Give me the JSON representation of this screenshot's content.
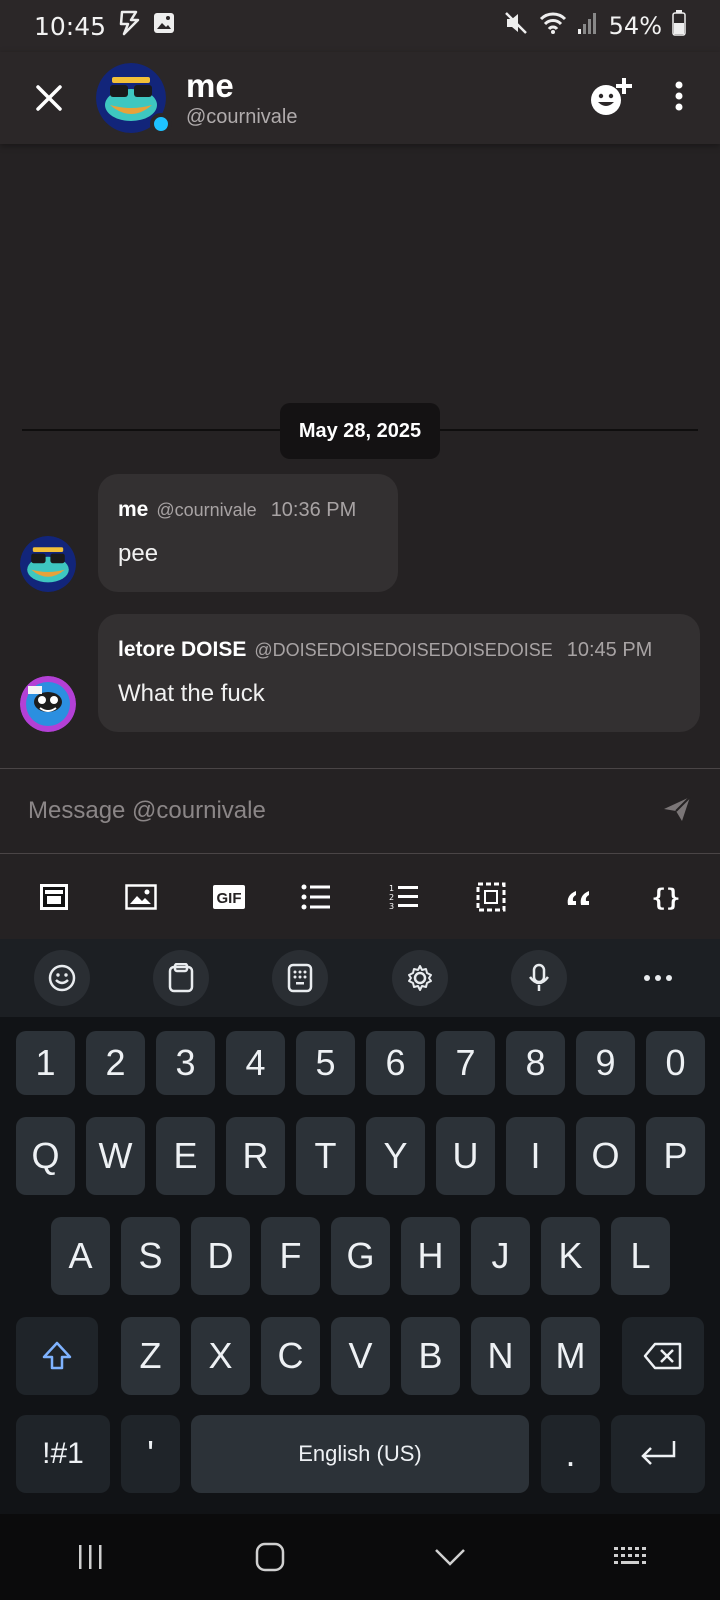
{
  "status_bar": {
    "time": "10:45",
    "battery": "54%"
  },
  "header": {
    "title": "me",
    "handle": "@cournivale"
  },
  "date_separator": "May 28, 2025",
  "messages": [
    {
      "author": "me",
      "username": "@cournivale",
      "time": "10:36 PM",
      "text": "pee"
    },
    {
      "author": "letore DOISE",
      "username": "@DOISEDOISEDOISEDOISEDOISE",
      "time": "10:45 PM",
      "text": "What the fuck"
    }
  ],
  "composer": {
    "placeholder": "Message @cournivale"
  },
  "toolbar": [
    "format-toggle",
    "image",
    "gif",
    "bullet-list",
    "numbered-list",
    "select-area",
    "quote",
    "code-block"
  ],
  "keyboard": {
    "numbers": [
      "1",
      "2",
      "3",
      "4",
      "5",
      "6",
      "7",
      "8",
      "9",
      "0"
    ],
    "row1": [
      "Q",
      "W",
      "E",
      "R",
      "T",
      "Y",
      "U",
      "I",
      "O",
      "P"
    ],
    "row2": [
      "A",
      "S",
      "D",
      "F",
      "G",
      "H",
      "J",
      "K",
      "L"
    ],
    "row3": [
      "Z",
      "X",
      "C",
      "V",
      "B",
      "N",
      "M"
    ],
    "symbols_key": "!#1",
    "apostrophe": "'",
    "space_label": "English (US)",
    "period": "."
  },
  "colors": {
    "background": "#252223",
    "bubble": "#333031",
    "online": "#1ec2ff",
    "keyboard": "#111316"
  }
}
